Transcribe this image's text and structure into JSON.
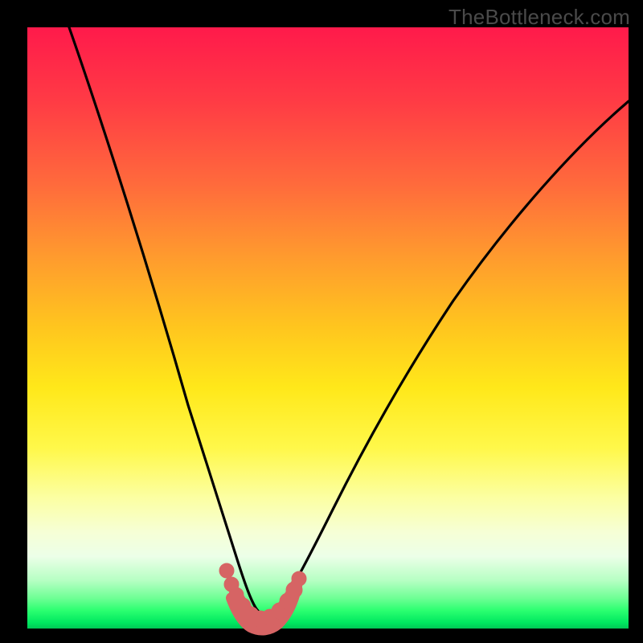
{
  "watermark": "TheBottleneck.com",
  "chart_data": {
    "type": "line",
    "title": "",
    "xlabel": "",
    "ylabel": "",
    "xlim": [
      0,
      100
    ],
    "ylim": [
      0,
      100
    ],
    "grid": false,
    "series": [
      {
        "name": "bottleneck-curve",
        "x": [
          7,
          10,
          13,
          16,
          19,
          22,
          25,
          28,
          30,
          32,
          33.5,
          35,
          36.5,
          38,
          40,
          44,
          50,
          56,
          62,
          70,
          80,
          90,
          100
        ],
        "y": [
          100,
          90,
          80.5,
          71,
          61.5,
          52,
          42,
          32,
          23,
          15,
          9,
          4.5,
          2,
          1,
          2,
          7,
          17,
          27,
          36,
          46,
          56,
          64,
          70
        ]
      }
    ],
    "highlight_band": {
      "name": "optimal-range",
      "x_start": 31,
      "x_end": 41,
      "y_center": 2.5
    },
    "gradient_stops": [
      {
        "pos": 0,
        "color": "#ff1a4b"
      },
      {
        "pos": 50,
        "color": "#ffe81a"
      },
      {
        "pos": 100,
        "color": "#00c856"
      }
    ]
  }
}
